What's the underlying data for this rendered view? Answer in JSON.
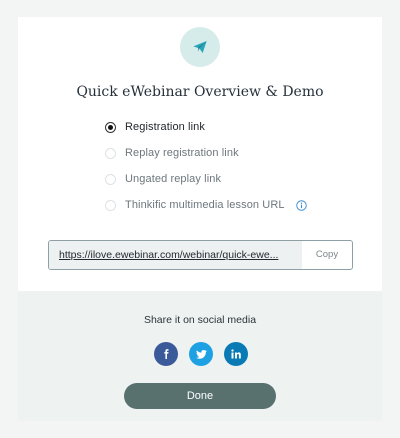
{
  "dialog": {
    "title": "Quick eWebinar Overview & Demo",
    "icon": "paper-plane-icon"
  },
  "options": [
    {
      "label": "Registration link",
      "selected": true
    },
    {
      "label": "Replay registration link",
      "selected": false
    },
    {
      "label": "Ungated replay link",
      "selected": false
    },
    {
      "label": "Thinkific multimedia lesson URL",
      "selected": false,
      "info_icon": "info-icon"
    }
  ],
  "link": {
    "url": "https://ilove.ewebinar.com/webinar/quick-ewe...",
    "copy_label": "Copy"
  },
  "share": {
    "label": "Share it on social media",
    "networks": [
      {
        "name": "facebook",
        "icon": "facebook-icon",
        "color": "#3b5a99"
      },
      {
        "name": "twitter",
        "icon": "twitter-icon",
        "color": "#1da1e2"
      },
      {
        "name": "linkedin",
        "icon": "linkedin-icon",
        "color": "#0a7ab5"
      }
    ]
  },
  "done_label": "Done",
  "colors": {
    "accent": "#58706e",
    "icon_circle": "#d6ecea",
    "icon": "#2aa5b8"
  }
}
